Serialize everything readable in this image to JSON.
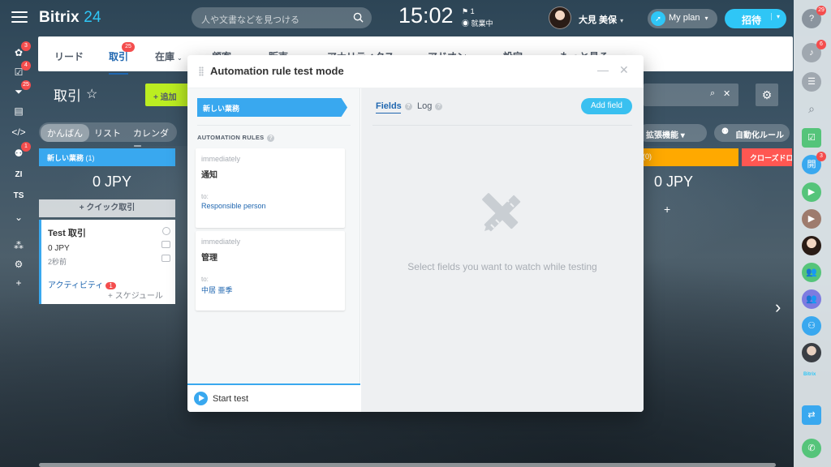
{
  "header": {
    "logo_main": "Bitrix",
    "logo_num": " 24",
    "search_placeholder": "人や文書などを見つける",
    "clock": "15:02",
    "clock_flag_count": "1",
    "work_status": "就業中",
    "user_name": "大見 美保",
    "myplan_label": "My plan",
    "invite_label": "招待"
  },
  "left_sidebar": {
    "badges": [
      "3",
      "4",
      "25",
      "1"
    ],
    "text_items": [
      "ZI",
      "TS"
    ]
  },
  "right_sidebar": {
    "badges": {
      "help": "29",
      "notifications": "6",
      "chat": "3"
    },
    "chat_label": "開",
    "brand": "Bitrix"
  },
  "crm": {
    "nav": {
      "items": [
        {
          "label": "リード",
          "active": false,
          "caret": false
        },
        {
          "label": "取引",
          "active": true,
          "caret": false,
          "badge": "25"
        },
        {
          "label": "在庫",
          "active": false,
          "caret": true
        },
        {
          "label": "顧客",
          "active": false,
          "caret": true
        },
        {
          "label": "販売",
          "active": false,
          "caret": true
        },
        {
          "label": "アナリティクス",
          "active": false,
          "caret": true
        },
        {
          "label": "アドオン",
          "active": false,
          "caret": true
        },
        {
          "label": "設定",
          "active": false,
          "caret": true
        },
        {
          "label": "もっと見る",
          "active": false,
          "caret": true
        }
      ]
    },
    "page_title": "取引",
    "add_label": "追加",
    "view_tabs": [
      "かんばん",
      "リスト",
      "カレンダー"
    ],
    "extensions_label": "拡張機能",
    "automation_rules_label": "自動化ルール",
    "columns": {
      "new": {
        "name": "新しい業務",
        "count": "(1)",
        "sum": "0 JPY"
      },
      "orange": {
        "count": "(0)",
        "sum": "0 JPY"
      },
      "red": {
        "name": "クローズドロスト"
      }
    },
    "quick_deal_label": "クイック取引",
    "deal": {
      "title": "Test 取引",
      "amount": "0 JPY",
      "time": "2秒前",
      "activity_label": "アクティビティ",
      "activity_badge": "1",
      "schedule_label": "+ スケジュール"
    }
  },
  "modal": {
    "title": "Automation rule test mode",
    "stage": "新しい業務",
    "rules_label": "AUTOMATION RULES",
    "rules": [
      {
        "when": "immediately",
        "name": "通知",
        "to_label": "to:",
        "recipient": "Responsible person"
      },
      {
        "when": "immediately",
        "name": "管理",
        "to_label": "to:",
        "recipient": "中居 亜季"
      }
    ],
    "start_label": "Start test",
    "tabs": {
      "fields": "Fields",
      "log": "Log"
    },
    "add_field_label": "Add field",
    "empty_text": "Select fields you want to watch while testing"
  }
}
